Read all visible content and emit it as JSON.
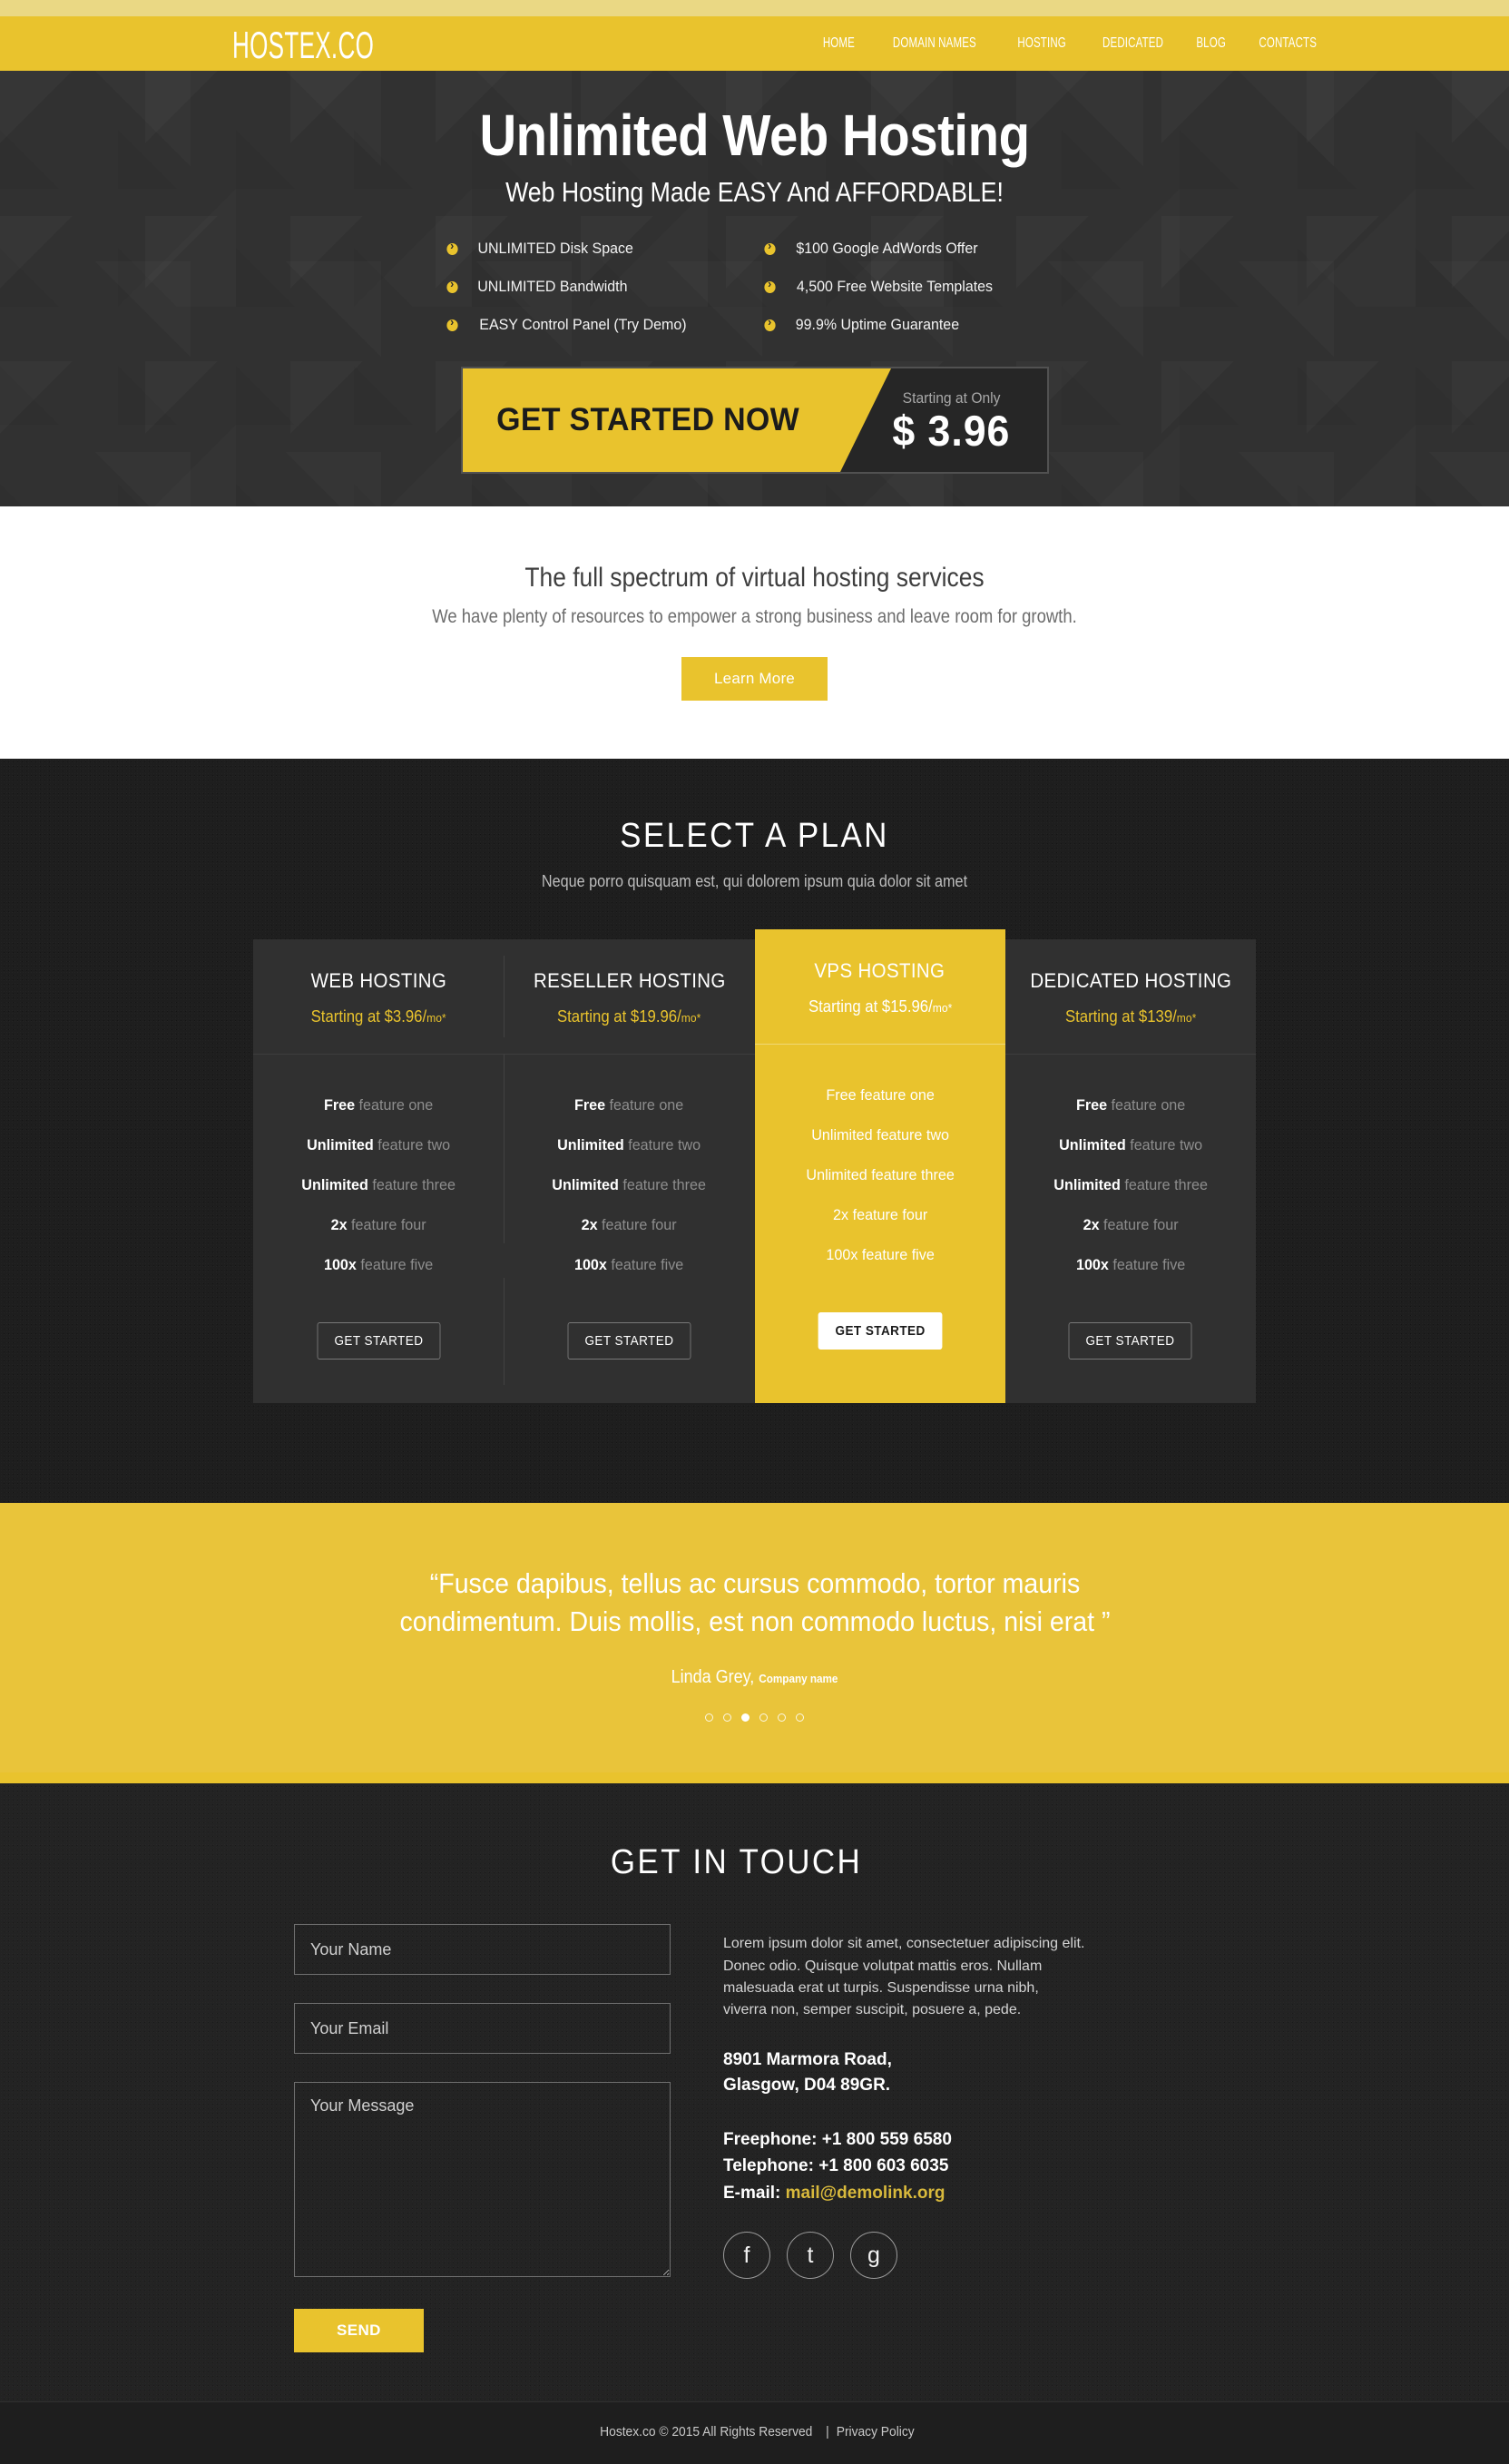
{
  "header": {
    "logo": "HOSTEX.CO",
    "nav": [
      {
        "label": "HOME"
      },
      {
        "label": "DOMAIN NAMES"
      },
      {
        "label": "HOSTING"
      },
      {
        "label": "DEDICATED"
      },
      {
        "label": "BLOG"
      },
      {
        "label": "CONTACTS"
      }
    ]
  },
  "hero": {
    "title": "Unlimited Web Hosting",
    "subtitle": "Web Hosting Made EASY And AFFORDABLE!",
    "features_left": [
      "UNLIMITED Disk Space",
      "UNLIMITED Bandwidth",
      "EASY Control Panel (Try Demo)"
    ],
    "features_right": [
      "$100 Google AdWords Offer",
      "4,500 Free Website Templates",
      "99.9% Uptime Guarantee"
    ],
    "cta_label": "GET STARTED NOW",
    "cta_small": "Starting at Only",
    "cta_price": "$ 3.96"
  },
  "spectrum": {
    "title": "The full spectrum of virtual hosting services",
    "text": "We have plenty of resources to empower a strong business and leave room for growth.",
    "button": "Learn More"
  },
  "plans": {
    "title": "SELECT A PLAN",
    "subtitle": "Neque porro quisquam est, qui dolorem ipsum quia dolor sit amet",
    "button_label": "GET STARTED",
    "columns": [
      {
        "name": "WEB HOSTING",
        "price": "Starting at $3.96/",
        "price_unit": "mo*",
        "featured": false,
        "features": [
          {
            "strong": "Free",
            "rest": " feature one"
          },
          {
            "strong": "Unlimited",
            "rest": " feature two"
          },
          {
            "strong": "Unlimited",
            "rest": " feature three"
          },
          {
            "strong": "2x",
            "rest": " feature four"
          },
          {
            "strong": "100x",
            "rest": " feature five"
          }
        ]
      },
      {
        "name": "RESELLER HOSTING",
        "price": "Starting at $19.96/",
        "price_unit": "mo*",
        "featured": false,
        "features": [
          {
            "strong": "Free",
            "rest": " feature one"
          },
          {
            "strong": "Unlimited",
            "rest": " feature two"
          },
          {
            "strong": "Unlimited",
            "rest": " feature three"
          },
          {
            "strong": "2x",
            "rest": " feature four"
          },
          {
            "strong": "100x",
            "rest": " feature five"
          }
        ]
      },
      {
        "name": "VPS HOSTING",
        "price": "Starting at $15.96/",
        "price_unit": "mo*",
        "featured": true,
        "features": [
          {
            "strong": "Free",
            "rest": " feature one"
          },
          {
            "strong": "Unlimited",
            "rest": " feature two"
          },
          {
            "strong": "Unlimited",
            "rest": " feature three"
          },
          {
            "strong": "2x",
            "rest": " feature four"
          },
          {
            "strong": "100x",
            "rest": " feature five"
          }
        ]
      },
      {
        "name": "DEDICATED HOSTING",
        "price": "Starting at $139/",
        "price_unit": "mo*",
        "featured": false,
        "features": [
          {
            "strong": "Free",
            "rest": " feature one"
          },
          {
            "strong": "Unlimited",
            "rest": " feature two"
          },
          {
            "strong": "Unlimited",
            "rest": " feature three"
          },
          {
            "strong": "2x",
            "rest": " feature four"
          },
          {
            "strong": "100x",
            "rest": " feature five"
          }
        ]
      }
    ]
  },
  "testimonial": {
    "quote": "“Fusce dapibus, tellus ac cursus commodo, tortor mauris condimentum. Duis mollis, est non commodo luctus, nisi erat ”",
    "author_name": "Linda Grey,",
    "author_company": "Company name",
    "dot_count": 6,
    "active_dot": 3
  },
  "contact": {
    "title": "GET IN TOUCH",
    "form": {
      "name_placeholder": "Your Name",
      "name_value": "",
      "email_placeholder": "Your Email",
      "email_value": "",
      "message_placeholder": "Your Message",
      "message_value": "",
      "send_label": "SEND"
    },
    "description": "Lorem ipsum dolor sit amet, consectetuer adipiscing elit. Donec odio. Quisque volutpat mattis eros. Nullam malesuada erat ut turpis. Suspendisse urna nibh, viverra non, semper suscipit, posuere a, pede.",
    "address_line1": "8901 Marmora Road,",
    "address_line2": "Glasgow, D04 89GR.",
    "freephone_label": "Freephone:",
    "freephone_value": "+1 800 559 6580",
    "telephone_label": "Telephone:",
    "telephone_value": "+1 800 603 6035",
    "email_label": "E-mail:",
    "email_value": "mail@demolink.org",
    "socials": [
      {
        "glyph": "f",
        "name": "facebook"
      },
      {
        "glyph": "t",
        "name": "twitter"
      },
      {
        "glyph": "g",
        "name": "google-plus"
      }
    ]
  },
  "footer": {
    "copyright": "Hostex.co © 2015 All Rights Reserved",
    "separator": "|",
    "privacy": "Privacy Policy"
  },
  "colors": {
    "brand_yellow": "#e9c32d",
    "dark": "#232323",
    "hero_dark": "#313131"
  }
}
